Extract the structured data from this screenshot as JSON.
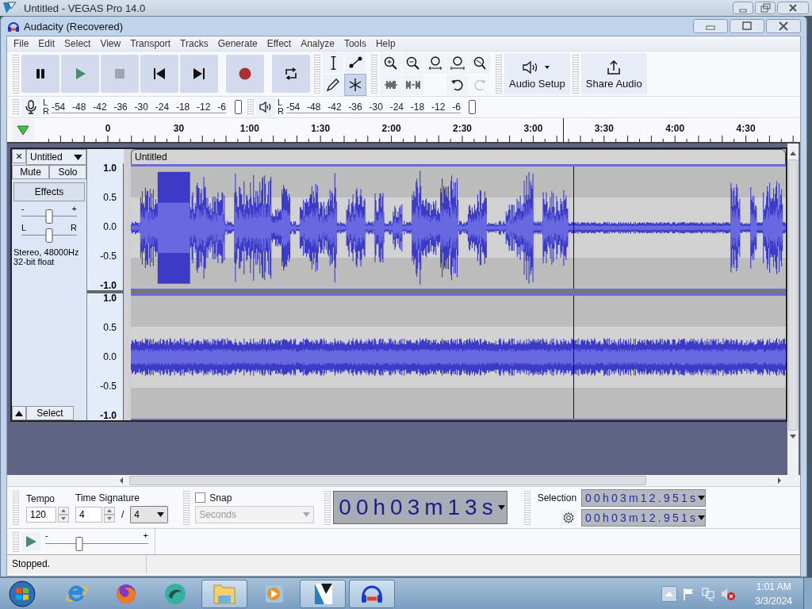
{
  "background_window": {
    "title": "Untitled - VEGAS Pro 14.0"
  },
  "window": {
    "title": "Audacity (Recovered)"
  },
  "menu": [
    "File",
    "Edit",
    "Select",
    "View",
    "Transport",
    "Tracks",
    "Generate",
    "Effect",
    "Analyze",
    "Tools",
    "Help"
  ],
  "transport": [
    {
      "kind": "pause"
    },
    {
      "kind": "play"
    },
    {
      "kind": "stop"
    },
    {
      "kind": "start"
    },
    {
      "kind": "end"
    },
    {
      "kind": "record"
    },
    {
      "kind": "loop"
    }
  ],
  "tools": [
    {
      "kind": "select",
      "selected": false
    },
    {
      "kind": "envelope",
      "selected": false
    },
    {
      "kind": "draw",
      "selected": false
    },
    {
      "kind": "multi",
      "selected": true
    }
  ],
  "edit_tools": [
    {
      "kind": "zoom-in",
      "disabled": false
    },
    {
      "kind": "zoom-out",
      "disabled": false
    },
    {
      "kind": "fit-selection",
      "disabled": false
    },
    {
      "kind": "fit-project",
      "disabled": false
    },
    {
      "kind": "zoom-toggle",
      "disabled": false
    },
    {
      "kind": "trim",
      "disabled": false
    },
    {
      "kind": "silence",
      "disabled": false
    },
    {
      "kind": "undo",
      "disabled": false
    },
    {
      "kind": "redo",
      "disabled": true
    }
  ],
  "audio_setup": {
    "label": "Audio Setup"
  },
  "share_audio": {
    "label": "Share Audio"
  },
  "recording_meter": {
    "channels": [
      "L",
      "R"
    ],
    "scale": [
      "-54",
      "-48",
      "-42",
      "-36",
      "-30",
      "-24",
      "-18",
      "-12",
      "-6"
    ],
    "level": 0.97
  },
  "playback_meter": {
    "channels": [
      "L",
      "R"
    ],
    "scale": [
      "-54",
      "-48",
      "-42",
      "-36",
      "-30",
      "-24",
      "-18",
      "-12",
      "-6"
    ],
    "level": 0.97
  },
  "timeline": {
    "ticks": [
      "0",
      "30",
      "1:00",
      "1:30",
      "2:00",
      "2:30",
      "3:00",
      "3:30",
      "4:00",
      "4:30"
    ]
  },
  "track": {
    "close": "×",
    "name": "Untitled",
    "mute": "Mute",
    "solo": "Solo",
    "effects": "Effects",
    "gain": {
      "min": "-",
      "max": "+",
      "level": 0.5
    },
    "pan": {
      "min": "L",
      "max": "R",
      "level": 0.5
    },
    "info": [
      "Stereo, 48000Hz",
      "32-bit float"
    ],
    "select": "Select",
    "clip_title": "Untitled",
    "channels": [
      {
        "scale": [
          "1.0",
          "0.5",
          "0.0",
          "-0.5",
          "-1.0"
        ],
        "kind": "speech"
      },
      {
        "scale": [
          "1.0",
          "0.5",
          "0.0",
          "-0.5",
          "-1.0"
        ],
        "kind": "steady"
      }
    ]
  },
  "tempo": {
    "label": "Tempo",
    "value": "120"
  },
  "time_signature": {
    "label": "Time Signature",
    "upper": "4",
    "separator": "/",
    "lower": "4"
  },
  "snap": {
    "label": "Snap",
    "checked": false,
    "unit": "Seconds"
  },
  "time_display": "00h03m13s",
  "selection": {
    "label": "Selection",
    "start": "00h03m12.951s",
    "end": "00h03m12.951s"
  },
  "play_at_speed": {
    "min": "-",
    "max": "+",
    "level": 0.33
  },
  "status": "Stopped.",
  "taskbar": {
    "apps": [
      {
        "kind": "browser-e",
        "running": false
      },
      {
        "kind": "fox",
        "running": false
      },
      {
        "kind": "swirl",
        "running": false
      },
      {
        "kind": "folder",
        "running": true
      },
      {
        "kind": "media",
        "running": false
      },
      {
        "kind": "film",
        "running": true
      },
      {
        "kind": "headphones",
        "running": true
      }
    ],
    "time": "1:01 AM",
    "date": "3/3/2024"
  }
}
